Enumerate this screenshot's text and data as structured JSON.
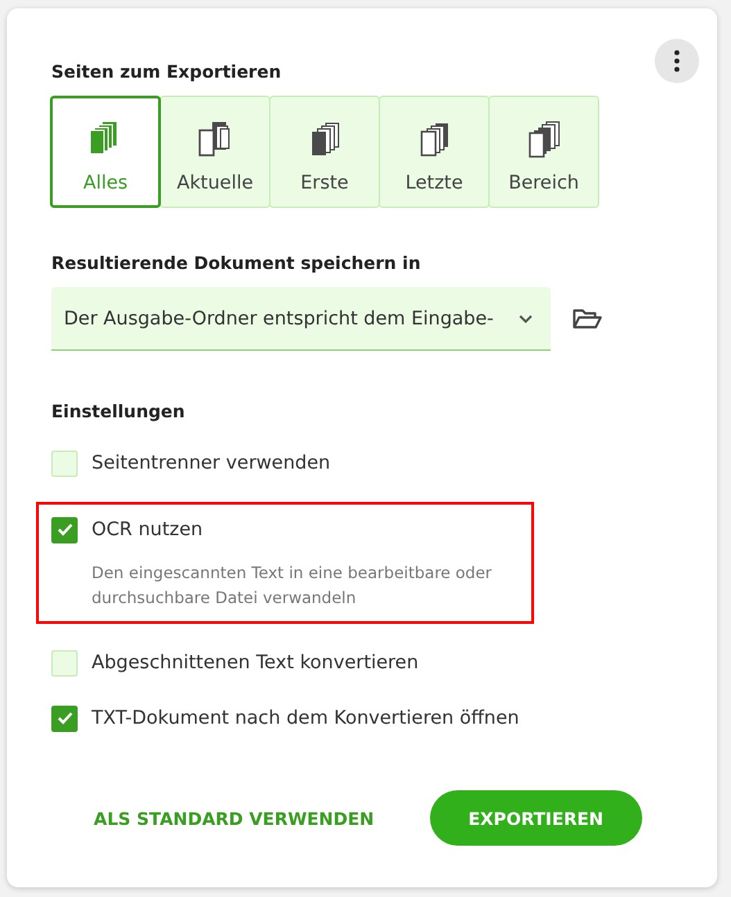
{
  "pages_section": {
    "title": "Seiten zum Exportieren",
    "tabs": [
      {
        "label": "Alles",
        "selected": true
      },
      {
        "label": "Aktuelle",
        "selected": false
      },
      {
        "label": "Erste",
        "selected": false
      },
      {
        "label": "Letzte",
        "selected": false
      },
      {
        "label": "Bereich",
        "selected": false
      }
    ]
  },
  "save_section": {
    "title": "Resultierende Dokument speichern in",
    "dropdown": {
      "value": "Der Ausgabe-Ordner entspricht dem Eingabe-"
    }
  },
  "settings_section": {
    "title": "Einstellungen",
    "options": [
      {
        "label": "Seitentrenner verwenden",
        "checked": false,
        "highlighted": false
      },
      {
        "label": "OCR nutzen",
        "checked": true,
        "highlighted": true,
        "description": "Den eingescannten Text in eine bearbeitbare oder durchsuchbare Datei verwandeln"
      },
      {
        "label": "Abgeschnittenen Text konvertieren",
        "checked": false,
        "highlighted": false
      },
      {
        "label": "TXT-Dokument nach dem Konvertieren öffnen",
        "checked": true,
        "highlighted": false
      }
    ]
  },
  "buttons": [
    {
      "label": "ALS STANDARD VERWENDEN",
      "kind": "text"
    },
    {
      "label": "EXPORTIEREN",
      "kind": "primary"
    }
  ]
}
